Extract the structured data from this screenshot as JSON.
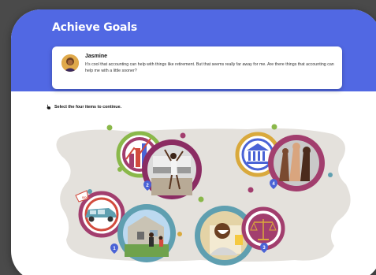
{
  "title": "Achieve Goals",
  "message": {
    "name": "Jasmine",
    "text": "It's cool that accounting can help with things like retirement. But that seems really far away for me. Are there things that accounting can help me with a little sooner?"
  },
  "instruction": "Select the four items to continue.",
  "items": [
    {
      "badge": "1",
      "icon": "car-icon",
      "photo": "house-family-photo"
    },
    {
      "badge": "2",
      "icon": "bar-chart-icon",
      "photo": "dancing-woman-photo"
    },
    {
      "badge": "3",
      "icon": "scales-icon",
      "photo": "laughing-man-photo"
    },
    {
      "badge": "4",
      "icon": "bank-icon",
      "photo": "raised-fists-photo"
    }
  ],
  "colors": {
    "header": "#5168e3",
    "badge": "#4a63d6",
    "backdrop": "#e4e1dc"
  }
}
